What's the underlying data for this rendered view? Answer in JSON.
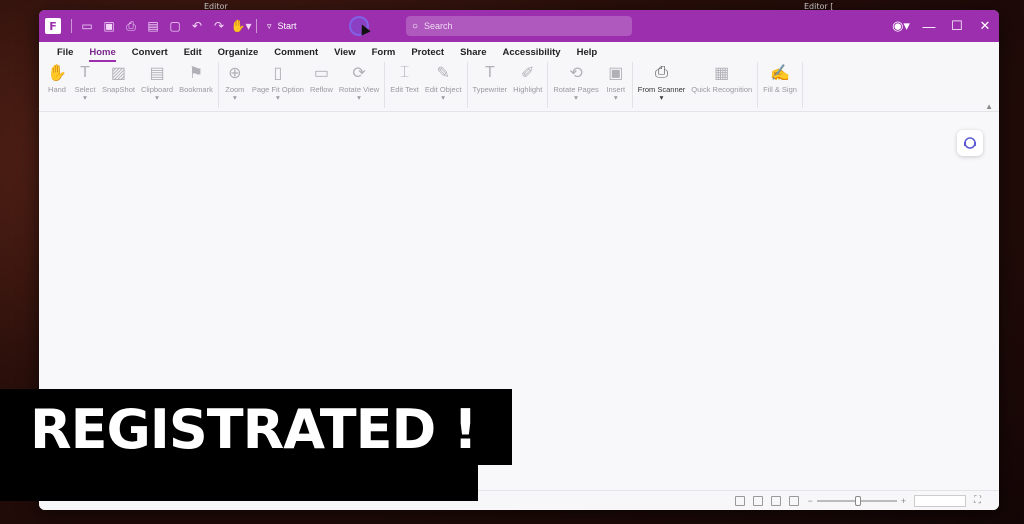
{
  "desktop": {
    "labels": [
      "Editor",
      "Editor ["
    ]
  },
  "app": {
    "logo_letter": "F",
    "quick_tools": [
      "open-folder-icon",
      "save-icon",
      "print-icon",
      "export-icon",
      "new-icon",
      "undo-icon",
      "redo-icon",
      "hand-dropdown-icon"
    ],
    "start_label": "Start",
    "search_placeholder": "Search"
  },
  "menu": [
    "File",
    "Home",
    "Convert",
    "Edit",
    "Organize",
    "Comment",
    "View",
    "Form",
    "Protect",
    "Share",
    "Accessibility",
    "Help"
  ],
  "active_menu": "Home",
  "ribbon": {
    "groups": [
      [
        {
          "label": "Hand",
          "icon": "hand-icon"
        },
        {
          "label": "Select",
          "icon": "select-icon",
          "dropdown": true
        },
        {
          "label": "SnapShot",
          "icon": "snapshot-icon"
        },
        {
          "label": "Clipboard",
          "icon": "clipboard-icon",
          "dropdown": true
        },
        {
          "label": "Bookmark",
          "icon": "bookmark-icon"
        }
      ],
      [
        {
          "label": "Zoom",
          "icon": "zoom-icon",
          "dropdown": true
        },
        {
          "label": "Page Fit Option",
          "icon": "page-fit-icon",
          "dropdown": true
        },
        {
          "label": "Reflow",
          "icon": "reflow-icon"
        },
        {
          "label": "Rotate View",
          "icon": "rotate-view-icon",
          "dropdown": true
        }
      ],
      [
        {
          "label": "Edit Text",
          "icon": "edit-text-icon"
        },
        {
          "label": "Edit Object",
          "icon": "edit-object-icon",
          "dropdown": true
        }
      ],
      [
        {
          "label": "Typewriter",
          "icon": "typewriter-icon"
        },
        {
          "label": "Highlight",
          "icon": "highlight-icon"
        }
      ],
      [
        {
          "label": "Rotate Pages",
          "icon": "rotate-pages-icon",
          "dropdown": true
        },
        {
          "label": "Insert",
          "icon": "insert-icon",
          "dropdown": true
        }
      ],
      [
        {
          "label": "From Scanner",
          "icon": "scanner-icon",
          "dropdown": true,
          "strong": true
        },
        {
          "label": "Quick Recognition",
          "icon": "ocr-icon"
        }
      ],
      [
        {
          "label": "Fill & Sign",
          "icon": "fill-sign-icon"
        }
      ]
    ]
  },
  "overlay": {
    "banner_text": "REGISTRATED !"
  },
  "colors": {
    "brand": "#9b2fae",
    "banner_bg": "#000000"
  }
}
